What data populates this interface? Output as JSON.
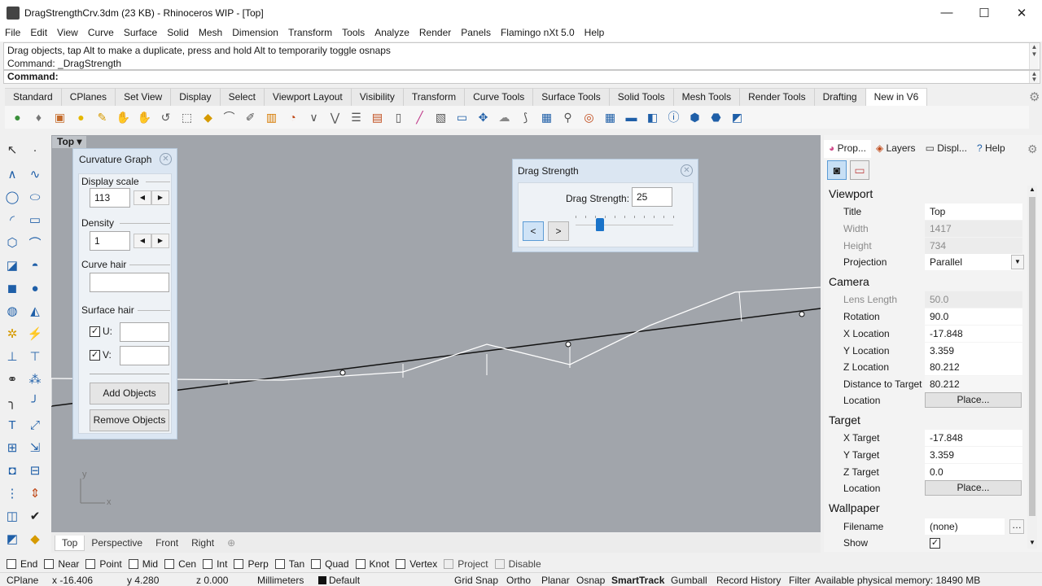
{
  "window": {
    "title": "DragStrengthCrv.3dm (23 KB) - Rhinoceros WIP - [Top]",
    "minimize_glyph": "—",
    "maximize_glyph": "☐",
    "close_glyph": "✕"
  },
  "menu": [
    "File",
    "Edit",
    "View",
    "Curve",
    "Surface",
    "Solid",
    "Mesh",
    "Dimension",
    "Transform",
    "Tools",
    "Analyze",
    "Render",
    "Panels",
    "Flamingo nXt 5.0",
    "Help"
  ],
  "command": {
    "history_line1": "Drag objects, tap Alt to make a duplicate, press and hold Alt to temporarily toggle osnaps",
    "history_line2": "Command: _DragStrength",
    "prompt": "Command:"
  },
  "toolbar_tabs": [
    "Standard",
    "CPlanes",
    "Set View",
    "Display",
    "Select",
    "Viewport Layout",
    "Visibility",
    "Transform",
    "Curve Tools",
    "Surface Tools",
    "Solid Tools",
    "Mesh Tools",
    "Render Tools",
    "Drafting",
    "New in V6"
  ],
  "active_toolbar_tab": "New in V6",
  "viewport": {
    "title": "Top",
    "tabs": [
      "Top",
      "Perspective",
      "Front",
      "Right"
    ],
    "add_tab_glyph": "⊕",
    "axis_x": "x",
    "axis_y": "y"
  },
  "curvature_graph": {
    "title": "Curvature Graph",
    "display_scale_label": "Display scale",
    "display_scale_value": "113",
    "density_label": "Density",
    "density_value": "1",
    "curve_hair_label": "Curve hair",
    "surface_hair_label": "Surface hair",
    "u_label": "U:",
    "v_label": "V:",
    "u_checked": true,
    "v_checked": true,
    "add_button": "Add Objects",
    "remove_button": "Remove Objects"
  },
  "drag_strength": {
    "title": "Drag Strength",
    "label": "Drag Strength:",
    "value": "25",
    "slider_fraction": 0.25,
    "decrease_glyph": "<",
    "increase_glyph": ">"
  },
  "properties": {
    "tabs": [
      "Prop...",
      "Layers",
      "Displ...",
      "Help"
    ],
    "viewport_section": "Viewport",
    "camera_section": "Camera",
    "target_section": "Target",
    "wallpaper_section": "Wallpaper",
    "viewport_rows": [
      {
        "label": "Title",
        "value": "Top"
      },
      {
        "label": "Width",
        "value": "1417"
      },
      {
        "label": "Height",
        "value": "734"
      },
      {
        "label": "Projection",
        "value": "Parallel"
      }
    ],
    "camera_rows": [
      {
        "label": "Lens Length",
        "value": "50.0"
      },
      {
        "label": "Rotation",
        "value": "90.0"
      },
      {
        "label": "X Location",
        "value": "-17.848"
      },
      {
        "label": "Y Location",
        "value": "3.359"
      },
      {
        "label": "Z Location",
        "value": "80.212"
      },
      {
        "label": "Distance to Target",
        "value": "80.212"
      },
      {
        "label": "Location",
        "value": "Place..."
      }
    ],
    "target_rows": [
      {
        "label": "X Target",
        "value": "-17.848"
      },
      {
        "label": "Y Target",
        "value": "3.359"
      },
      {
        "label": "Z Target",
        "value": "0.0"
      },
      {
        "label": "Location",
        "value": "Place..."
      }
    ],
    "wallpaper_rows": [
      {
        "label": "Filename",
        "value": "(none)"
      },
      {
        "label": "Show",
        "value": "✓"
      }
    ]
  },
  "osnaps": [
    {
      "label": "End",
      "checked": false
    },
    {
      "label": "Near",
      "checked": false
    },
    {
      "label": "Point",
      "checked": false
    },
    {
      "label": "Mid",
      "checked": false
    },
    {
      "label": "Cen",
      "checked": false
    },
    {
      "label": "Int",
      "checked": false
    },
    {
      "label": "Perp",
      "checked": false
    },
    {
      "label": "Tan",
      "checked": false
    },
    {
      "label": "Quad",
      "checked": false
    },
    {
      "label": "Knot",
      "checked": false
    },
    {
      "label": "Vertex",
      "checked": false
    },
    {
      "label": "Project",
      "checked": false,
      "disabled": true
    },
    {
      "label": "Disable",
      "checked": false,
      "disabled": true
    }
  ],
  "status": {
    "cplane": "CPlane",
    "x": "x -16.406",
    "y": "y 4.280",
    "z": "z 0.000",
    "units": "Millimeters",
    "layer": "Default",
    "grid_snap": "Grid Snap",
    "ortho": "Ortho",
    "planar": "Planar",
    "osnap": "Osnap",
    "smarttrack": "SmartTrack",
    "gumball": "Gumball",
    "record_history": "Record History",
    "filter": "Filter",
    "memory": "Available physical memory: 18490 MB"
  }
}
